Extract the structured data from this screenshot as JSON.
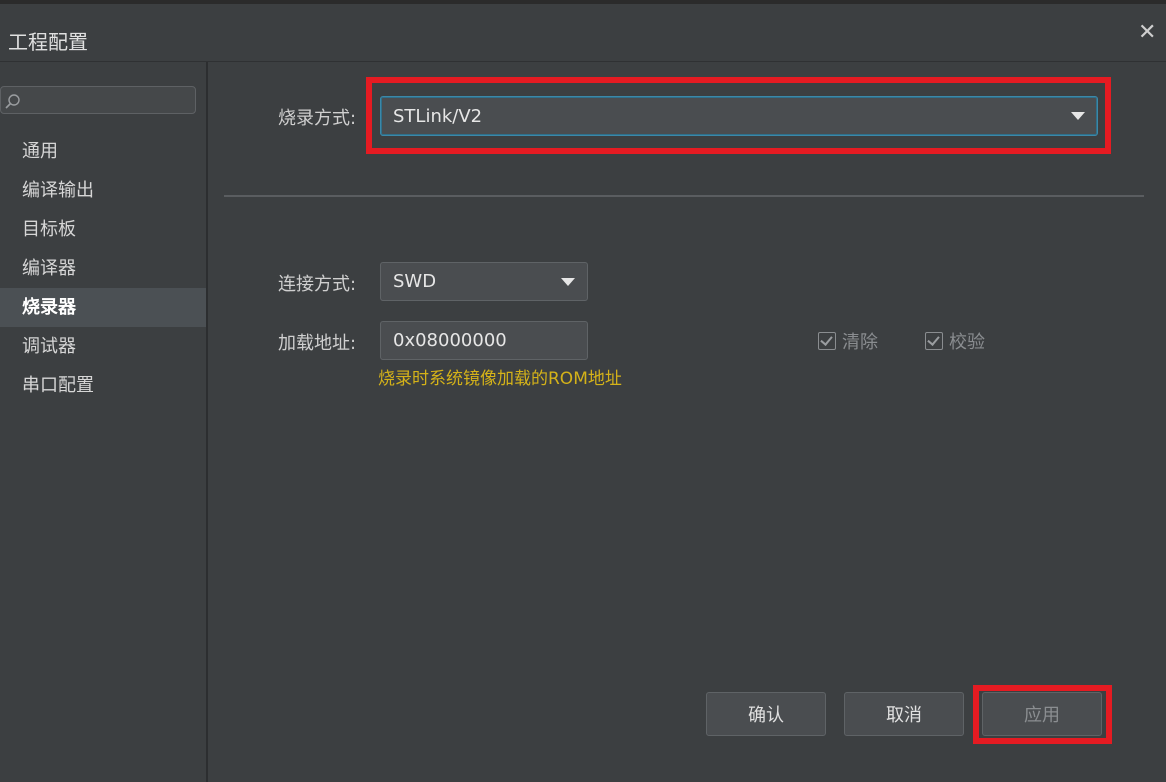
{
  "dialog": {
    "title": "工程配置",
    "close_glyph": "✕"
  },
  "search": {
    "placeholder": "",
    "value": "",
    "icon": "search-icon"
  },
  "sidebar": {
    "items": [
      {
        "label": "通用",
        "active": false
      },
      {
        "label": "编译输出",
        "active": false
      },
      {
        "label": "目标板",
        "active": false
      },
      {
        "label": "编译器",
        "active": false
      },
      {
        "label": "烧录器",
        "active": true
      },
      {
        "label": "调试器",
        "active": false
      },
      {
        "label": "串口配置",
        "active": false
      }
    ]
  },
  "programmer": {
    "method_label": "烧录方式:",
    "method_value": "STLink/V2",
    "connection_label": "连接方式:",
    "connection_value": "SWD",
    "load_address_label": "加载地址:",
    "load_address_value": "0x08000000",
    "load_address_hint": "烧录时系统镜像加载的ROM地址",
    "erase_label": "清除",
    "erase_checked": true,
    "verify_label": "校验",
    "verify_checked": true
  },
  "buttons": {
    "ok": "确认",
    "cancel": "取消",
    "apply": "应用"
  },
  "colors": {
    "highlight": "#e51b22",
    "hint": "#d4b219",
    "background": "#3c3f41"
  }
}
